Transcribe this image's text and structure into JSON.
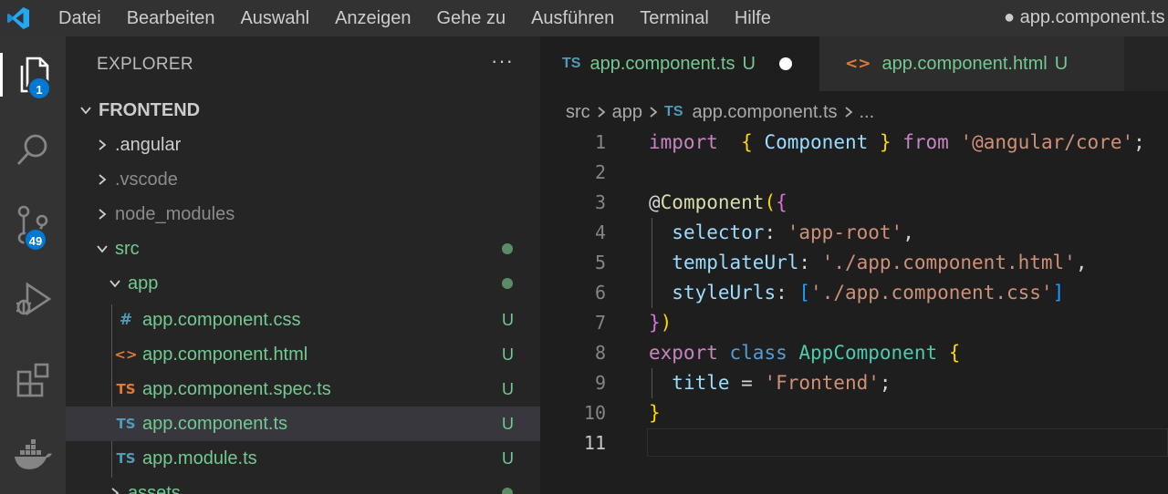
{
  "titlebar": {
    "logo_icon": "vscode-logo",
    "menu": [
      "Datei",
      "Bearbeiten",
      "Auswahl",
      "Anzeigen",
      "Gehe zu",
      "Ausführen",
      "Terminal",
      "Hilfe"
    ],
    "window_title": "● app.component.ts"
  },
  "activity_bar": {
    "items": [
      {
        "icon": "explorer-icon",
        "badge": "1"
      },
      {
        "icon": "search-icon"
      },
      {
        "icon": "source-control-icon",
        "badge": "49"
      },
      {
        "icon": "run-debug-icon"
      },
      {
        "icon": "extensions-icon"
      },
      {
        "icon": "docker-icon"
      }
    ]
  },
  "sidebar": {
    "title": "EXPLORER",
    "more": "···",
    "root": "FRONTEND",
    "tree": [
      {
        "label": ".angular",
        "type": "folder",
        "expanded": false
      },
      {
        "label": ".vscode",
        "type": "folder",
        "expanded": false
      },
      {
        "label": "node_modules",
        "type": "folder",
        "expanded": false
      },
      {
        "label": "src",
        "type": "folder",
        "expanded": true,
        "status": "dot"
      },
      {
        "label": "app",
        "type": "folder",
        "expanded": true,
        "status": "dot"
      },
      {
        "label": "app.component.css",
        "type": "css",
        "icon_glyph": "#",
        "status": "U"
      },
      {
        "label": "app.component.html",
        "type": "html",
        "icon_glyph": "<>",
        "status": "U"
      },
      {
        "label": "app.component.spec.ts",
        "type": "ts-spec",
        "icon_glyph": "TS",
        "status": "U"
      },
      {
        "label": "app.component.ts",
        "type": "ts",
        "icon_glyph": "TS",
        "status": "U",
        "selected": true
      },
      {
        "label": "app.module.ts",
        "type": "ts",
        "icon_glyph": "TS",
        "status": "U"
      },
      {
        "label": "assets",
        "type": "folder",
        "expanded": false,
        "status": "dot"
      }
    ]
  },
  "tabs": [
    {
      "icon_glyph": "TS",
      "label": "app.component.ts",
      "status": "U",
      "dirty": true,
      "active": true
    },
    {
      "icon_glyph": "<>",
      "label": "app.component.html",
      "status": "U",
      "active": false
    }
  ],
  "breadcrumb": {
    "parts": [
      "src",
      "app"
    ],
    "file_icon": "TS",
    "file": "app.component.ts",
    "trail": "..."
  },
  "editor": {
    "current_line": 11,
    "lines": [
      {
        "n": "1",
        "tokens": [
          [
            "k1",
            "import"
          ],
          [
            "",
            "  "
          ],
          [
            "br1",
            "{"
          ],
          [
            "",
            " "
          ],
          [
            "prop",
            "Component"
          ],
          [
            "",
            " "
          ],
          [
            "br1",
            "}"
          ],
          [
            "",
            " "
          ],
          [
            "k1",
            "from"
          ],
          [
            "",
            " "
          ],
          [
            "str",
            "'@angular/core'"
          ],
          [
            "",
            ";"
          ]
        ]
      },
      {
        "n": "2",
        "tokens": []
      },
      {
        "n": "3",
        "tokens": [
          [
            "",
            "@"
          ],
          [
            "dec",
            "Component"
          ],
          [
            "br1",
            "("
          ],
          [
            "br2",
            "{"
          ]
        ]
      },
      {
        "n": "4",
        "tokens": [
          [
            "",
            "  "
          ],
          [
            "prop",
            "selector"
          ],
          [
            "",
            ": "
          ],
          [
            "str",
            "'app-root'"
          ],
          [
            "",
            ","
          ]
        ]
      },
      {
        "n": "5",
        "tokens": [
          [
            "",
            "  "
          ],
          [
            "prop",
            "templateUrl"
          ],
          [
            "",
            ": "
          ],
          [
            "str",
            "'./app.component.html'"
          ],
          [
            "",
            ","
          ]
        ]
      },
      {
        "n": "6",
        "tokens": [
          [
            "",
            "  "
          ],
          [
            "prop",
            "styleUrls"
          ],
          [
            "",
            ": "
          ],
          [
            "br3",
            "["
          ],
          [
            "str",
            "'./app.component.css'"
          ],
          [
            "br3",
            "]"
          ]
        ]
      },
      {
        "n": "7",
        "tokens": [
          [
            "br2",
            "}"
          ],
          [
            "br1",
            ")"
          ]
        ]
      },
      {
        "n": "8",
        "tokens": [
          [
            "k1",
            "export"
          ],
          [
            "",
            " "
          ],
          [
            "k2",
            "class"
          ],
          [
            "",
            " "
          ],
          [
            "cls",
            "AppComponent"
          ],
          [
            "",
            " "
          ],
          [
            "br1",
            "{"
          ]
        ]
      },
      {
        "n": "9",
        "tokens": [
          [
            "",
            "  "
          ],
          [
            "prop",
            "title"
          ],
          [
            "",
            " = "
          ],
          [
            "str",
            "'Frontend'"
          ],
          [
            "",
            ";"
          ]
        ]
      },
      {
        "n": "10",
        "tokens": [
          [
            "br1",
            "}"
          ]
        ]
      },
      {
        "n": "11",
        "tokens": []
      }
    ]
  },
  "colors": {
    "accent_badge": "#0078d4",
    "untracked_green": "#73c991",
    "ts_blue": "#519aba",
    "html_orange": "#e37933"
  }
}
